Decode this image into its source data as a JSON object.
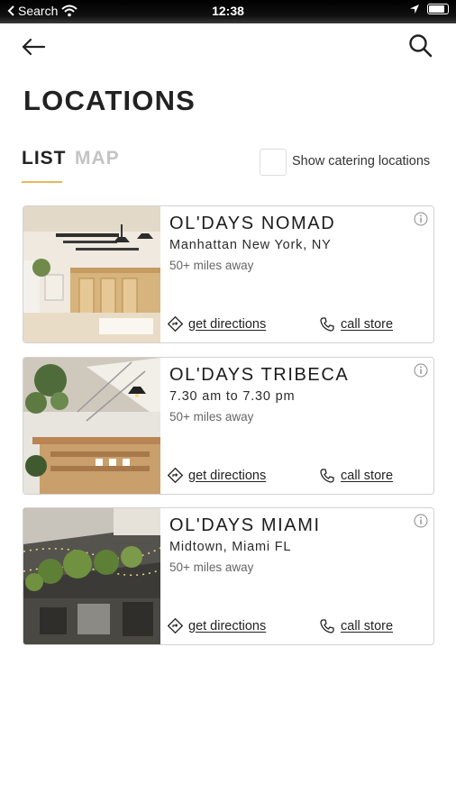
{
  "status_bar": {
    "back_app": "Search",
    "time": "12:38"
  },
  "header": {
    "title": "LOCATIONS"
  },
  "tabs": {
    "list_label": "LIST",
    "map_label": "MAP"
  },
  "filter": {
    "catering_label": "Show catering locations"
  },
  "locations": [
    {
      "name": "OL'DAYS NOMAD",
      "subtitle": "Manhattan New York, NY",
      "distance": "50+ miles away",
      "directions_label": "get directions",
      "call_label": "call store"
    },
    {
      "name": "OL'DAYS TRIBECA",
      "subtitle": "7.30 am to 7.30 pm",
      "distance": "50+ miles away",
      "directions_label": "get directions",
      "call_label": "call store"
    },
    {
      "name": "OL'DAYS MIAMI",
      "subtitle": "Midtown, Miami FL",
      "distance": "50+ miles away",
      "directions_label": "get directions",
      "call_label": "call store"
    }
  ],
  "colors": {
    "accent_underline": "#e6b85c",
    "inactive_tab": "#c4c4c4",
    "card_border": "#d2d2d2"
  }
}
